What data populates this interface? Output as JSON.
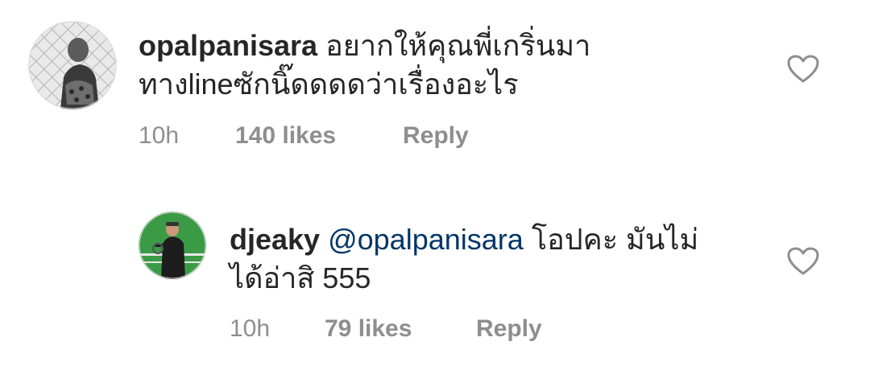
{
  "comments": [
    {
      "username": "opalpanisara",
      "text_line1": "อยากให้คุณพี่เกริ่นมา",
      "text_line2": "ทางlineซักนิ๊ดดดดว่าเรื่องอะไร",
      "time": "10h",
      "likes": "140 likes",
      "reply": "Reply",
      "avatar_icon": "avatar-photo-icon",
      "like_icon": "heart-outline-icon"
    },
    {
      "username": "djeaky",
      "mention": "@opalpanisara",
      "text_line1": "โอปคะ มันไม่",
      "text_line2": "ได้อ่าสิ 555",
      "time": "10h",
      "likes": "79 likes",
      "reply": "Reply",
      "avatar_icon": "avatar-photo-icon",
      "like_icon": "heart-outline-icon"
    }
  ],
  "colors": {
    "text": "#262626",
    "muted": "#8e8e8e",
    "mention": "#003569"
  }
}
